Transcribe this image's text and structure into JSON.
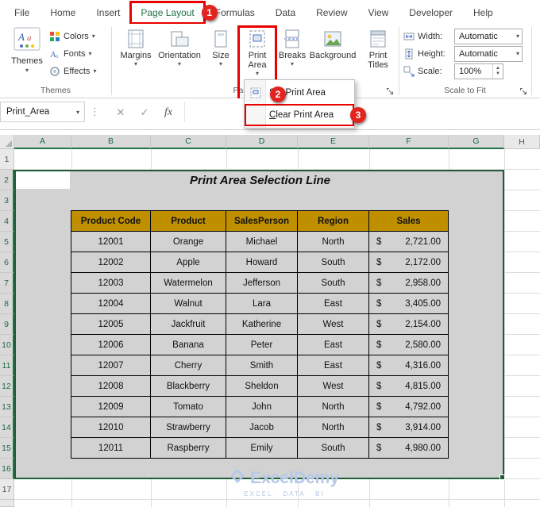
{
  "colors": {
    "accent_green": "#217346",
    "table_header_gold": "#BF8F00",
    "annotation_red": "#E80000",
    "selection_gray": "#D2D2D2",
    "watermark_blue": "#B6C8E8"
  },
  "ribbon": {
    "tabs": [
      "File",
      "Home",
      "Insert",
      "Page Layout",
      "Formulas",
      "Data",
      "Review",
      "View",
      "Developer",
      "Help"
    ],
    "active_tab": "Page Layout",
    "groups": {
      "themes": {
        "caption": "Themes",
        "main_button": "Themes",
        "items": [
          {
            "label": "Colors",
            "icon": "colors-icon"
          },
          {
            "label": "Fonts",
            "icon": "fonts-icon"
          },
          {
            "label": "Effects",
            "icon": "effects-icon"
          }
        ]
      },
      "page_setup": {
        "caption": "Page Setup",
        "buttons": [
          {
            "label": "Margins",
            "icon": "margins-icon",
            "dropdown": true,
            "annotated": false
          },
          {
            "label": "Orientation",
            "icon": "orientation-icon",
            "dropdown": true,
            "annotated": false
          },
          {
            "label": "Size",
            "icon": "size-icon",
            "dropdown": true,
            "annotated": false
          },
          {
            "label": "Print Area",
            "icon": "print-area-icon",
            "dropdown": true,
            "annotated": true
          },
          {
            "label": "Breaks",
            "icon": "breaks-icon",
            "dropdown": true,
            "annotated": false
          },
          {
            "label": "Background",
            "icon": "background-icon",
            "dropdown": false,
            "annotated": false
          },
          {
            "label": "Print Titles",
            "icon": "print-titles-icon",
            "dropdown": false,
            "annotated": false
          }
        ]
      },
      "scale_to_fit": {
        "caption": "Scale to Fit",
        "fields": [
          {
            "label": "Width:",
            "value": "Automatic",
            "icon": "width-icon",
            "control": "dropdown"
          },
          {
            "label": "Height:",
            "value": "Automatic",
            "icon": "height-icon",
            "control": "dropdown"
          },
          {
            "label": "Scale:",
            "value": "100%",
            "icon": "scale-icon",
            "control": "spinner"
          }
        ]
      }
    }
  },
  "annotations": {
    "step1": "1",
    "step2": "2",
    "step3": "3"
  },
  "name_box": {
    "value": "Print_Area"
  },
  "formula_bar": {
    "cancel_glyph": "✕",
    "enter_glyph": "✓",
    "fx_label": "fx"
  },
  "print_area_menu": {
    "items": [
      {
        "label": "Set Print Area",
        "icon": "set-print-area-icon",
        "annotated": false,
        "accelerator": ""
      },
      {
        "label": "Clear Print Area",
        "icon": "",
        "annotated": true,
        "accelerator": "C"
      }
    ]
  },
  "sheet": {
    "columns": [
      "A",
      "B",
      "C",
      "D",
      "E",
      "F",
      "G",
      "H"
    ],
    "selected_columns": [
      "A",
      "B",
      "C",
      "D",
      "E",
      "F",
      "G"
    ],
    "rows": [
      1,
      2,
      3,
      4,
      5,
      6,
      7,
      8,
      9,
      10,
      11,
      12,
      13,
      14,
      15,
      16,
      17
    ],
    "selected_rows": [
      2,
      3,
      4,
      5,
      6,
      7,
      8,
      9,
      10,
      11,
      12,
      13,
      14,
      15,
      16
    ],
    "title": "Print Area Selection Line",
    "table": {
      "headers": [
        "Product Code",
        "Product",
        "SalesPerson",
        "Region",
        "Sales"
      ],
      "currency_symbol": "$",
      "rows": [
        {
          "code": "12001",
          "product": "Orange",
          "salesperson": "Michael",
          "region": "North",
          "sales": "2,721.00"
        },
        {
          "code": "12002",
          "product": "Apple",
          "salesperson": "Howard",
          "region": "South",
          "sales": "2,172.00"
        },
        {
          "code": "12003",
          "product": "Watermelon",
          "salesperson": "Jefferson",
          "region": "South",
          "sales": "2,958.00"
        },
        {
          "code": "12004",
          "product": "Walnut",
          "salesperson": "Lara",
          "region": "East",
          "sales": "3,405.00"
        },
        {
          "code": "12005",
          "product": "Jackfruit",
          "salesperson": "Katherine",
          "region": "West",
          "sales": "2,154.00"
        },
        {
          "code": "12006",
          "product": "Banana",
          "salesperson": "Peter",
          "region": "East",
          "sales": "2,580.00"
        },
        {
          "code": "12007",
          "product": "Cherry",
          "salesperson": "Smith",
          "region": "East",
          "sales": "4,316.00"
        },
        {
          "code": "12008",
          "product": "Blackberry",
          "salesperson": "Sheldon",
          "region": "West",
          "sales": "4,815.00"
        },
        {
          "code": "12009",
          "product": "Tomato",
          "salesperson": "John",
          "region": "North",
          "sales": "4,792.00"
        },
        {
          "code": "12010",
          "product": "Strawberry",
          "salesperson": "Jacob",
          "region": "North",
          "sales": "3,914.00"
        },
        {
          "code": "12011",
          "product": "Raspberry",
          "salesperson": "Emily",
          "region": "South",
          "sales": "4,980.00"
        }
      ]
    }
  },
  "watermark": {
    "brand": "ExcelDemy",
    "tagline": "EXCEL · DATA · BI"
  }
}
